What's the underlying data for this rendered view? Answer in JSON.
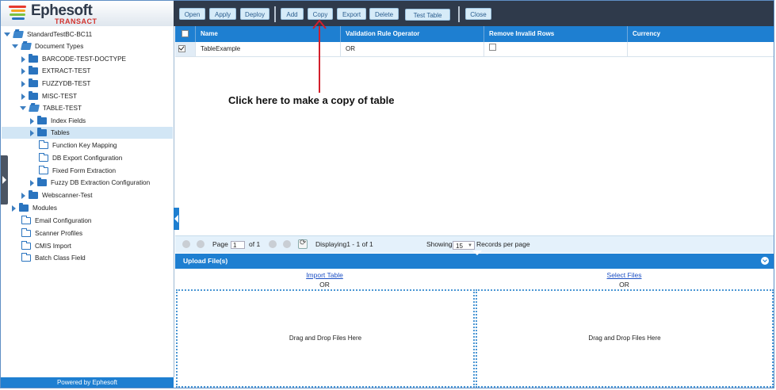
{
  "app": {
    "logo_text": "Ephesoft",
    "logo_sub": "TRANSACT",
    "footer": "Powered by Ephesoft"
  },
  "toolbar": {
    "open": "Open",
    "apply": "Apply",
    "deploy": "Deploy",
    "add": "Add",
    "copy": "Copy",
    "export": "Export",
    "delete": "Delete",
    "test_table": "Test Table",
    "close": "Close"
  },
  "tree": {
    "root": "StandardTestBC-BC11",
    "document_types": "Document Types",
    "doc_types": [
      "BARCODE-TEST-DOCTYPE",
      "EXTRACT-TEST",
      "FUZZYDB-TEST",
      "MISC-TEST",
      "TABLE-TEST"
    ],
    "table_test_children": [
      "Index Fields",
      "Tables",
      "Function Key Mapping",
      "DB Export Configuration",
      "Fixed Form Extraction",
      "Fuzzy DB Extraction Configuration"
    ],
    "webscanner": "Webscanner-Test",
    "modules": "Modules",
    "bottom_items": [
      "Email Configuration",
      "Scanner Profiles",
      "CMIS Import",
      "Batch Class Field"
    ]
  },
  "grid": {
    "columns": [
      "Name",
      "Validation Rule Operator",
      "Remove Invalid Rows",
      "Currency"
    ],
    "rows": [
      {
        "name": "TableExample",
        "operator": "OR",
        "remove_invalid": false,
        "currency": "",
        "selected": true
      }
    ]
  },
  "annotation": {
    "text": "Click here to make a copy of table",
    "color": "#d21f2b"
  },
  "pager": {
    "page_label": "Page",
    "page_value": "1",
    "of_label": "of 1",
    "displaying": "Displaying1 - 1 of 1",
    "showing": "Showing",
    "per_page_value": "15",
    "records_per_page": "Records per page"
  },
  "upload": {
    "title": "Upload File(s)",
    "import_table": "Import Table",
    "select_files": "Select Files",
    "or": "OR",
    "drop_text": "Drag and Drop Files Here"
  },
  "colors": {
    "accent": "#1e7fd1",
    "topbar": "#2f3a4b",
    "button_bg": "#d6ebf8"
  }
}
